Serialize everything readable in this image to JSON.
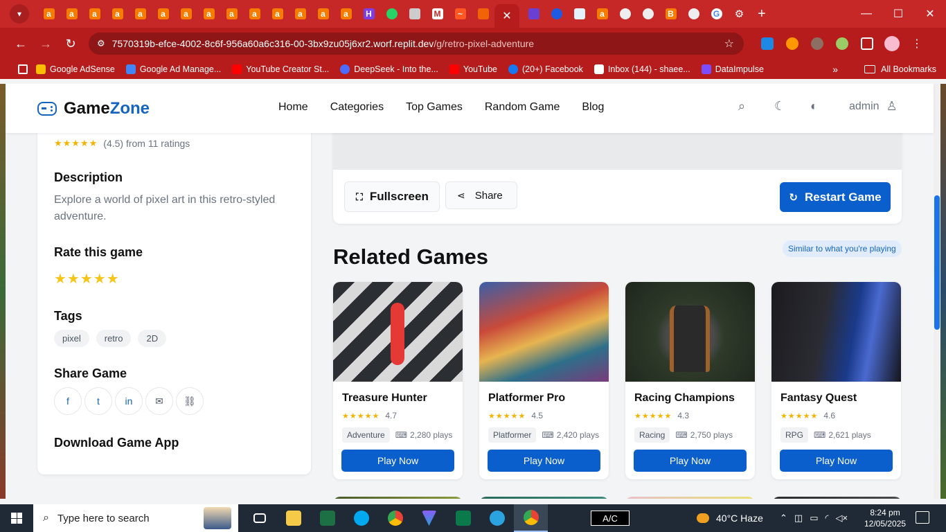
{
  "browser": {
    "url_host": "7570319b-efce-4002-8c6f-956a60a6c316-00-3bx9zu05j6xr2.worf.replit.dev",
    "url_path": "/g/retro-pixel-adventure",
    "bookmarks": [
      "Google AdSense",
      "Google Ad Manage...",
      "YouTube Creator St...",
      "DeepSeek - Into the...",
      "YouTube",
      "(20+) Facebook",
      "Inbox (144) - shaee...",
      "DataImpulse"
    ],
    "all_bookmarks": "All Bookmarks"
  },
  "site": {
    "logo_game": "Game",
    "logo_zone": "Zone",
    "nav": [
      "Home",
      "Categories",
      "Top Games",
      "Random Game",
      "Blog"
    ],
    "user": "admin"
  },
  "sidebar": {
    "rating_text": "(4.5) from 11 ratings",
    "description_title": "Description",
    "description": "Explore a world of pixel art in this retro-styled adventure.",
    "rate_title": "Rate this game",
    "tags_title": "Tags",
    "tags": [
      "pixel",
      "retro",
      "2D"
    ],
    "share_title": "Share Game",
    "download_title": "Download Game App"
  },
  "game_panel": {
    "fullscreen": "Fullscreen",
    "share": "Share",
    "restart": "Restart Game"
  },
  "related": {
    "title": "Related Games",
    "badge": "Similar to what you're playing",
    "games": [
      {
        "title": "Treasure Hunter",
        "rating": "4.7",
        "genre": "Adventure",
        "plays": "2,280 plays",
        "cta": "Play Now"
      },
      {
        "title": "Platformer Pro",
        "rating": "4.5",
        "genre": "Platformer",
        "plays": "2,420 plays",
        "cta": "Play Now"
      },
      {
        "title": "Racing Champions",
        "rating": "4.3",
        "genre": "Racing",
        "plays": "2,750 plays",
        "cta": "Play Now"
      },
      {
        "title": "Fantasy Quest",
        "rating": "4.6",
        "genre": "RPG",
        "plays": "2,621 plays",
        "cta": "Play Now"
      }
    ]
  },
  "taskbar": {
    "search_placeholder": "Type here to search",
    "ac": "A/C",
    "weather": "40°C  Haze",
    "time": "8:24 pm",
    "date": "12/05/2025"
  },
  "colors": {
    "brand": "#1565c0",
    "button": "#0b5fcc",
    "chrome": "#c62828",
    "star": "#f5b301"
  }
}
